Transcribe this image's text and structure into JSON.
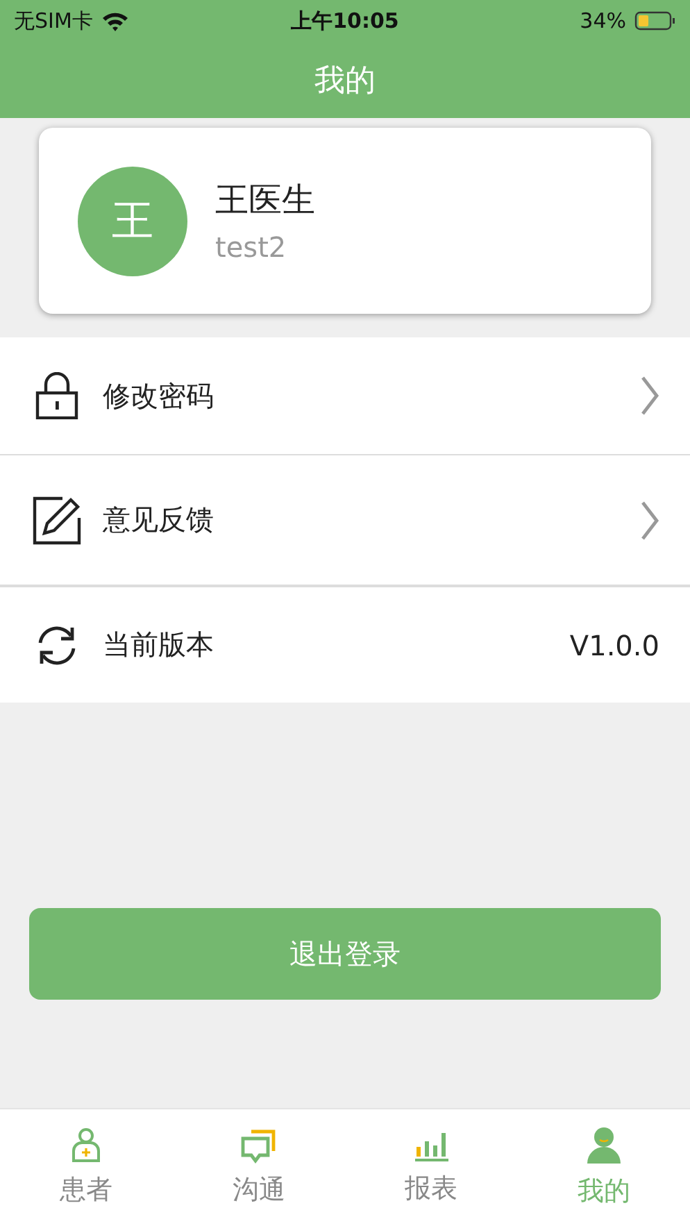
{
  "status_bar": {
    "carrier": "无SIM卡",
    "time": "上午10:05",
    "battery": "34%"
  },
  "header": {
    "title": "我的"
  },
  "profile": {
    "avatar": "王",
    "name": "王医生",
    "account": "test2"
  },
  "menu": [
    {
      "kind": "link",
      "label": "修改密码"
    },
    {
      "kind": "link",
      "label": "意见反馈"
    },
    {
      "kind": "value",
      "label": "当前版本",
      "value": "V1.0.0"
    }
  ],
  "logout_button": "退出登录",
  "tabs": [
    {
      "label": "患者",
      "selected": false
    },
    {
      "label": "沟通",
      "selected": false
    },
    {
      "label": "报表",
      "selected": false
    },
    {
      "label": "我的",
      "selected": true
    }
  ]
}
